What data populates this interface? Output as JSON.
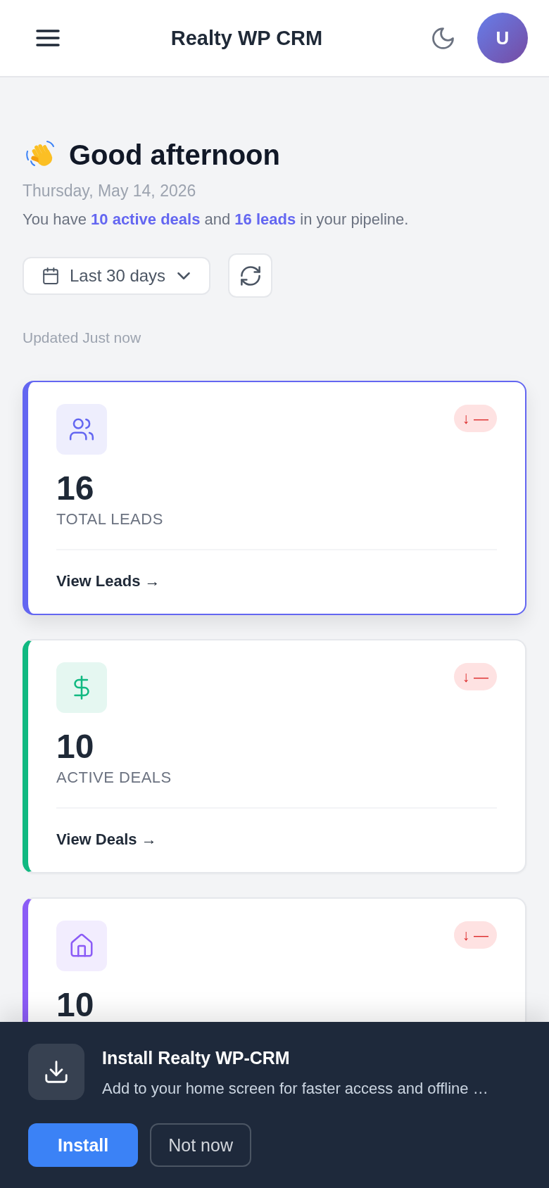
{
  "header": {
    "title": "Realty WP CRM",
    "avatar": "U"
  },
  "greeting": {
    "title": "Good afternoon",
    "date": "Thursday, May 14, 2026",
    "summary": "You have **10 active deals** and **16 leads** in your pipeline."
  },
  "filters": {
    "range": "Last 30 days",
    "updated": "Updated Just now"
  },
  "cards": [
    {
      "kind": "people",
      "color": "#6366f1",
      "highlighted": true,
      "trend": "↓ —",
      "value": "16",
      "label": "TOTAL LEADS",
      "link": "View Leads →"
    },
    {
      "kind": "money",
      "color": "#10b981",
      "highlighted": false,
      "trend": "↓ —",
      "value": "10",
      "label": "ACTIVE DEALS",
      "link": "View Deals →"
    },
    {
      "kind": "house",
      "color": "#8b5cf6",
      "highlighted": false,
      "trend": "↓ —",
      "value": "10"
    }
  ],
  "install_banner": {
    "title": "Install Realty WP-CRM",
    "description": "Add to your home screen for faster access and offline …",
    "buttons": [
      {
        "label": "Install",
        "kind": "primary"
      },
      {
        "label": "Not now",
        "kind": "secondary"
      }
    ]
  }
}
